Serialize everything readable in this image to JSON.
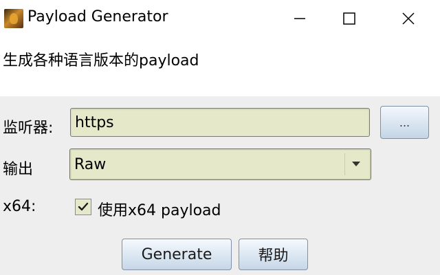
{
  "window": {
    "title": "Payload Generator",
    "minimize_icon": "minimize-icon",
    "maximize_icon": "maximize-icon",
    "close_icon": "close-icon"
  },
  "description": "生成各种语言版本的payload",
  "form": {
    "listener": {
      "label": "监听器:",
      "value": "https",
      "browse_label": "..."
    },
    "output": {
      "label": "输出",
      "selected": "Raw"
    },
    "x64": {
      "label": "x64:",
      "checked": true,
      "checkbox_label": "使用x64 payload"
    }
  },
  "buttons": {
    "generate": "Generate",
    "help": "帮助"
  },
  "colors": {
    "field_bg": "#e6e9c9",
    "form_bg": "#eeeeee",
    "button_gradient_top": "#f5f9fd",
    "button_gradient_bottom": "#c7d6e7"
  }
}
